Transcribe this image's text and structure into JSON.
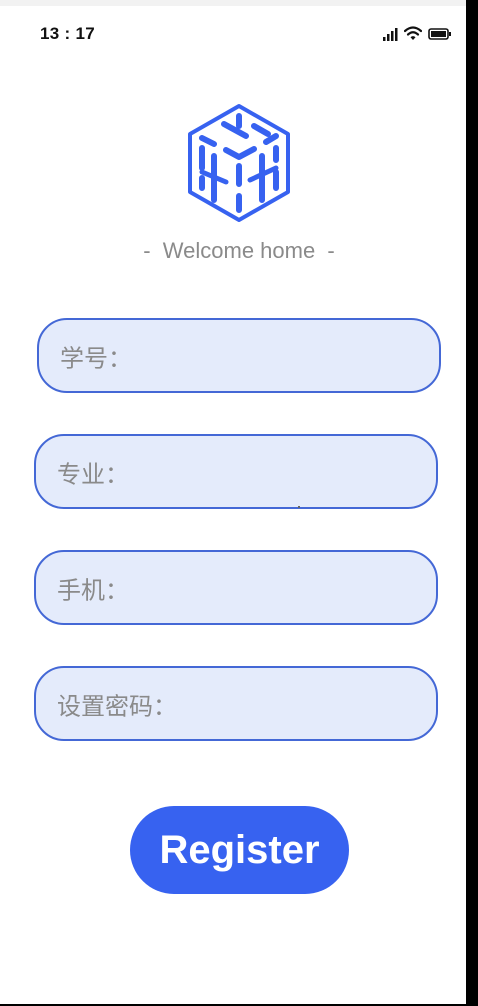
{
  "status_bar": {
    "time": "13 : 17",
    "icons": [
      "signal-icon",
      "wifi-icon",
      "battery-icon"
    ]
  },
  "brand": {
    "logo_icon": "cube-logo-icon",
    "accent_color": "#3762f0",
    "welcome_text": "-  Welcome home  -"
  },
  "form": {
    "fields": [
      {
        "label": "学号：",
        "value": ""
      },
      {
        "label": "专业：",
        "value": ""
      },
      {
        "label": "手机：",
        "value": ""
      },
      {
        "label": "设置密码：",
        "value": ""
      }
    ],
    "field_fill_color": "#e4ebfb",
    "field_border_color": "#4468d6"
  },
  "actions": {
    "register_label": "Register"
  }
}
